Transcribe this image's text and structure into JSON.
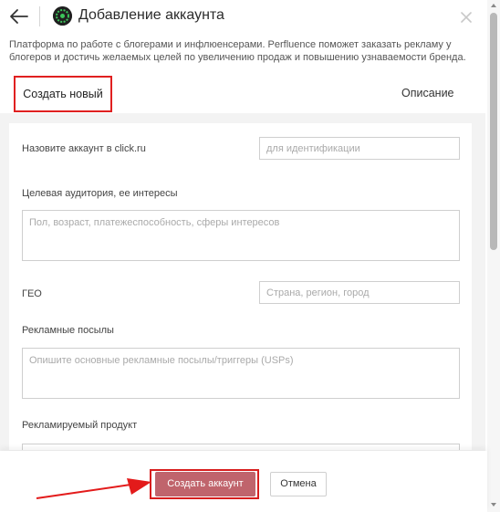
{
  "header": {
    "title": "Добавление аккаунта"
  },
  "description": "Платформа по работе с блогерами и инфлюенсерами. Perfluence поможет заказать рекламу у блогеров и достичь желаемых целей по увеличению продаж и повышению узнаваемости бренда.",
  "tabs": {
    "create": "Создать новый",
    "description": "Описание"
  },
  "form": {
    "account_name": {
      "label": "Назовите аккаунт в click.ru",
      "placeholder": "для идентификации"
    },
    "audience": {
      "label": "Целевая аудитория, ее интересы",
      "placeholder": "Пол, возраст, платежеспособность, сферы интересов"
    },
    "geo": {
      "label": "ГЕО",
      "placeholder": "Страна, регион, город"
    },
    "usp": {
      "label": "Рекламные посылы",
      "placeholder": "Опишите основные рекламные посылы/триггеры (USPs)"
    },
    "product": {
      "label": "Рекламируемый продукт"
    }
  },
  "footer": {
    "create_label": "Создать аккаунт",
    "cancel_label": "Отмена"
  },
  "colors": {
    "highlight": "#e02020",
    "primary_button": "#c0646c"
  }
}
